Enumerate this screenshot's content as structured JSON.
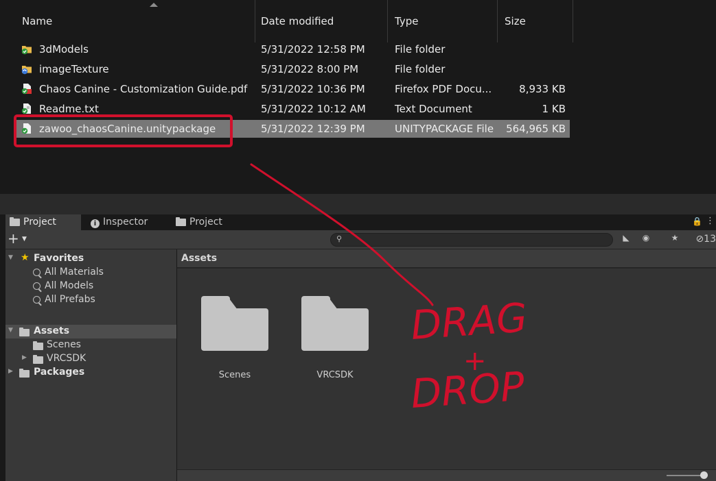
{
  "explorer": {
    "columns": {
      "name": "Name",
      "date": "Date modified",
      "type": "Type",
      "size": "Size"
    },
    "files": [
      {
        "name": "3dModels",
        "date": "5/31/2022 12:58 PM",
        "type": "File folder",
        "size": "",
        "icon": "folder-sync-icon"
      },
      {
        "name": "imageTexture",
        "date": "5/31/2022 8:00 PM",
        "type": "File folder",
        "size": "",
        "icon": "folder-sync-pending-icon"
      },
      {
        "name": "Chaos Canine - Customization Guide.pdf",
        "date": "5/31/2022 10:36 PM",
        "type": "Firefox PDF Docu...",
        "size": "8,933 KB",
        "icon": "pdf-file-icon"
      },
      {
        "name": "Readme.txt",
        "date": "5/31/2022 10:12 AM",
        "type": "Text Document",
        "size": "1 KB",
        "icon": "text-file-icon"
      },
      {
        "name": "zawoo_chaosCanine.unitypackage",
        "date": "5/31/2022 12:39 PM",
        "type": "UNITYPACKAGE File",
        "size": "564,965 KB",
        "icon": "file-icon"
      }
    ]
  },
  "unity": {
    "tabs": [
      {
        "label": "Project"
      },
      {
        "label": "Inspector"
      },
      {
        "label": "Project"
      }
    ],
    "toolbar": {
      "add": "+",
      "search_placeholder": "",
      "hidden_count": "13"
    },
    "tree": {
      "favorites": "Favorites",
      "all_materials": "All Materials",
      "all_models": "All Models",
      "all_prefabs": "All Prefabs",
      "assets": "Assets",
      "scenes": "Scenes",
      "vrcsdk": "VRCSDK",
      "packages": "Packages"
    },
    "assets_header": "Assets",
    "folders": [
      {
        "label": "Scenes"
      },
      {
        "label": "VRCSDK"
      }
    ]
  },
  "annotation": {
    "line1": "DRAG",
    "line2": "+",
    "line3": "DROP",
    "color": "#d0102c"
  }
}
